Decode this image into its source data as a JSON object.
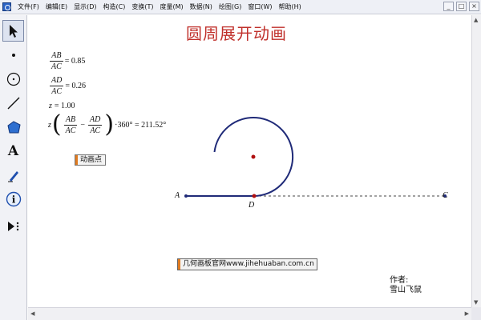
{
  "menubar": {
    "items": [
      "文件(F)",
      "编辑(E)",
      "显示(D)",
      "构造(C)",
      "变换(T)",
      "度量(M)",
      "数据(N)",
      "绘图(G)",
      "窗口(W)",
      "帮助(H)"
    ],
    "window_buttons": [
      "_",
      "□",
      "×"
    ]
  },
  "toolbar": {
    "tools": [
      {
        "name": "arrow-select-tool",
        "icon": "arrow-icon"
      },
      {
        "name": "point-tool",
        "icon": "point-icon"
      },
      {
        "name": "compass-tool",
        "icon": "circle-icon"
      },
      {
        "name": "straightedge-tool",
        "icon": "line-icon"
      },
      {
        "name": "polygon-tool",
        "icon": "polygon-icon"
      },
      {
        "name": "text-tool",
        "icon": "text-a-icon",
        "glyph": "A"
      },
      {
        "name": "marker-tool",
        "icon": "pen-icon"
      },
      {
        "name": "information-tool",
        "icon": "info-icon",
        "glyph": "i"
      },
      {
        "name": "custom-tool",
        "icon": "play-custom-icon"
      }
    ]
  },
  "canvas": {
    "title": "圆周展开动画",
    "measurements": {
      "ab_ac": {
        "num": "AB",
        "den": "AC",
        "rhs": "= 0.85"
      },
      "ad_ac": {
        "num": "AD",
        "den": "AC",
        "rhs": "= 0.26"
      },
      "z": {
        "lhs": "z",
        "rhs": "= 1.00"
      },
      "formula": {
        "z": "z",
        "f1_num": "AB",
        "f1_den": "AC",
        "minus": "−",
        "f2_num": "AD",
        "f2_den": "AC",
        "tail": "·360° = 211.52°"
      }
    },
    "animate_button": "动画点",
    "website_button": "几何画板官网www.jihehuaban.com.cn",
    "points": {
      "A": "A",
      "C": "C",
      "D": "D"
    },
    "author": {
      "line1": "作者:",
      "line2": "雪山飞鼠"
    },
    "colors": {
      "title": "#c0302b",
      "arc": "#1f2a78",
      "point": "#b01010",
      "dashed": "#444444"
    }
  }
}
